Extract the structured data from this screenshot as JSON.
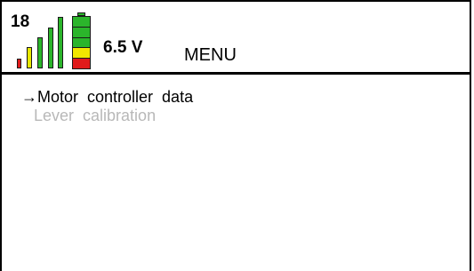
{
  "status": {
    "signal_value": "18",
    "signal_level_bars": 5,
    "battery_voltage": "6.5 V",
    "battery_cells_top_to_bottom": [
      "green",
      "green",
      "green",
      "yellow",
      "red"
    ],
    "colors": {
      "green": "#2bb52b",
      "yellow": "#f2e600",
      "red": "#e01b1b",
      "bar_red": "#e01b1b",
      "bar_yellow": "#e8e800",
      "bar_green": "#2bb52b"
    }
  },
  "screen": {
    "title": "MENU"
  },
  "menu": {
    "items": [
      {
        "label": "→Motor  controller  data",
        "state": "selected"
      },
      {
        "label": "Lever  calibration",
        "state": "disabled"
      }
    ]
  }
}
